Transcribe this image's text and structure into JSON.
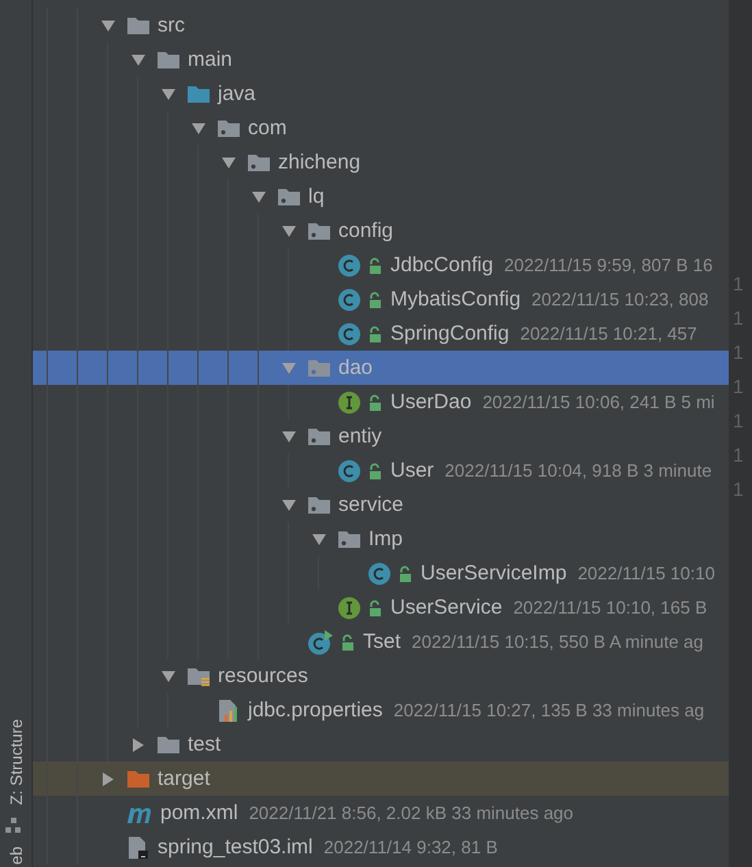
{
  "side_strip": {
    "tool_window": "Z: Structure",
    "tool_window_2": "eb"
  },
  "tree": [
    {
      "name": "src",
      "kind": "folder",
      "expanded": true,
      "selected": false,
      "children": [
        {
          "name": "main",
          "kind": "folder",
          "expanded": true,
          "selected": false,
          "children": [
            {
              "name": "java",
              "kind": "source-folder",
              "expanded": true,
              "selected": false,
              "children": [
                {
                  "name": "com",
                  "kind": "package",
                  "expanded": true,
                  "selected": false,
                  "children": [
                    {
                      "name": "zhicheng",
                      "kind": "package",
                      "expanded": true,
                      "selected": false,
                      "children": [
                        {
                          "name": "lq",
                          "kind": "package",
                          "expanded": true,
                          "selected": false,
                          "children": [
                            {
                              "name": "config",
                              "kind": "package",
                              "expanded": true,
                              "selected": false,
                              "children": [
                                {
                                  "name": "JdbcConfig",
                                  "kind": "class",
                                  "selected": false,
                                  "meta": "2022/11/15 9:59, 807 B 16"
                                },
                                {
                                  "name": "MybatisConfig",
                                  "kind": "class",
                                  "selected": false,
                                  "meta": "2022/11/15 10:23, 808"
                                },
                                {
                                  "name": "SpringConfig",
                                  "kind": "class",
                                  "selected": false,
                                  "meta": "2022/11/15 10:21, 457"
                                }
                              ]
                            },
                            {
                              "name": "dao",
                              "kind": "package",
                              "expanded": true,
                              "selected": true,
                              "children": [
                                {
                                  "name": "UserDao",
                                  "kind": "interface",
                                  "selected": false,
                                  "meta": "2022/11/15 10:06, 241 B 5 mi"
                                }
                              ]
                            },
                            {
                              "name": "entiy",
                              "kind": "package",
                              "expanded": true,
                              "selected": false,
                              "children": [
                                {
                                  "name": "User",
                                  "kind": "class",
                                  "selected": false,
                                  "meta": "2022/11/15 10:04, 918 B 3 minute"
                                }
                              ]
                            },
                            {
                              "name": "service",
                              "kind": "package",
                              "expanded": true,
                              "selected": false,
                              "children": [
                                {
                                  "name": "Imp",
                                  "kind": "package",
                                  "expanded": true,
                                  "selected": false,
                                  "children": [
                                    {
                                      "name": "UserServiceImp",
                                      "kind": "class",
                                      "selected": false,
                                      "meta": "2022/11/15 10:10"
                                    }
                                  ]
                                },
                                {
                                  "name": "UserService",
                                  "kind": "interface",
                                  "selected": false,
                                  "meta": "2022/11/15 10:10, 165 B"
                                }
                              ]
                            },
                            {
                              "name": "Tset",
                              "kind": "runnable-class",
                              "selected": false,
                              "meta": "2022/11/15 10:15, 550 B A minute ag"
                            }
                          ]
                        }
                      ]
                    }
                  ]
                }
              ]
            },
            {
              "name": "resources",
              "kind": "resources-folder",
              "expanded": true,
              "selected": false,
              "children": [
                {
                  "name": "jdbc.properties",
                  "kind": "properties",
                  "selected": false,
                  "meta": "2022/11/15 10:27, 135 B 33 minutes ag"
                }
              ]
            }
          ]
        },
        {
          "name": "test",
          "kind": "folder",
          "expanded": false,
          "selected": false
        }
      ]
    },
    {
      "name": "target",
      "kind": "excluded-folder",
      "expanded": false,
      "selected": false
    },
    {
      "name": "pom.xml",
      "kind": "maven",
      "selected": false,
      "meta": "2022/11/21 8:56, 2.02 kB 33 minutes ago"
    },
    {
      "name": "spring_test03.iml",
      "kind": "module-file",
      "selected": false,
      "meta": "2022/11/14 9:32, 81 B"
    }
  ],
  "gutter": {
    "line_numbers": [
      "1",
      "1",
      "1",
      "1",
      "1",
      "1",
      "1"
    ]
  }
}
